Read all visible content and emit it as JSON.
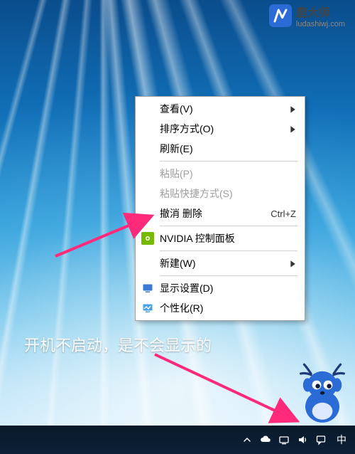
{
  "context_menu": {
    "items": [
      {
        "label": "查看(V)",
        "submenu": true
      },
      {
        "label": "排序方式(O)",
        "submenu": true
      },
      {
        "label": "刷新(E)"
      },
      {
        "sep": true
      },
      {
        "label": "粘贴(P)",
        "disabled": true
      },
      {
        "label": "粘贴快捷方式(S)",
        "disabled": true
      },
      {
        "label": "撤消 删除",
        "shortcut": "Ctrl+Z"
      },
      {
        "sep": true
      },
      {
        "label": "NVIDIA 控制面板",
        "icon": "nvidia"
      },
      {
        "sep": true
      },
      {
        "label": "新建(W)",
        "submenu": true
      },
      {
        "sep": true
      },
      {
        "label": "显示设置(D)",
        "icon": "display"
      },
      {
        "label": "个性化(R)",
        "icon": "personalize"
      }
    ]
  },
  "caption": "开机不启动，是不会显示的",
  "taskbar": {
    "ime": "中",
    "icons": [
      "tray-up",
      "onedrive",
      "network",
      "volume",
      "action-center"
    ]
  },
  "watermark": {
    "title": "鹿大师",
    "sub": "ludashiwj.com"
  }
}
